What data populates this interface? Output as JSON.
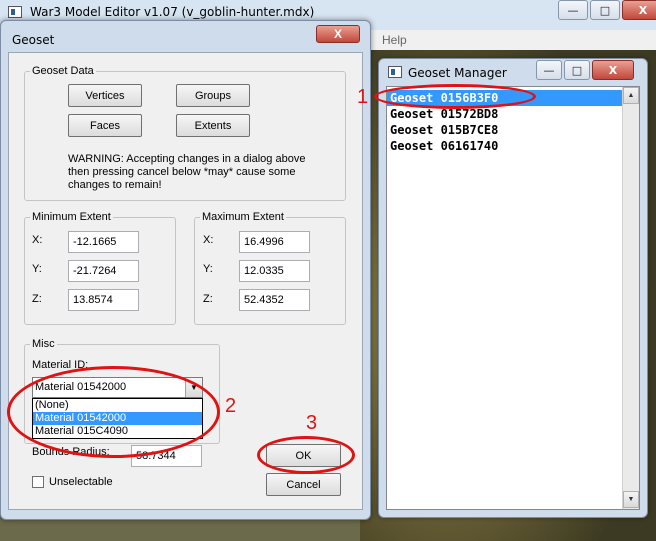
{
  "main_window": {
    "title": "War3 Model Editor v1.07 (v_goblin-hunter.mdx)",
    "menu_help": "Help",
    "buttons": {
      "minimize": "—",
      "maximize": "□",
      "close": "X"
    }
  },
  "dialog": {
    "title": "Geoset",
    "close": "X",
    "geoset_data": {
      "label": "Geoset Data",
      "vertices": "Vertices",
      "groups": "Groups",
      "faces": "Faces",
      "extents": "Extents",
      "warning": "WARNING: Accepting changes in a dialog above then pressing cancel below *may* cause some changes to remain!"
    },
    "minimum_extent": {
      "label": "Minimum Extent",
      "x_label": "X:",
      "x": "-12.1665",
      "y_label": "Y:",
      "y": "-21.7264",
      "z_label": "Z:",
      "z": "13.8574"
    },
    "maximum_extent": {
      "label": "Maximum Extent",
      "x_label": "X:",
      "x": "16.4996",
      "y_label": "Y:",
      "y": "12.0335",
      "z_label": "Z:",
      "z": "52.4352"
    },
    "misc": {
      "label": "Misc",
      "material_label": "Material ID:",
      "material_selected": "Material 01542000",
      "options": [
        "(None)",
        "Material 01542000",
        "Material 015C4090"
      ],
      "bounds_label": "Bounds Radius:",
      "bounds_value": "58.7344",
      "unselectable": "Unselectable"
    },
    "ok": "OK",
    "cancel": "Cancel"
  },
  "manager": {
    "title": "Geoset Manager",
    "buttons": {
      "minimize": "—",
      "maximize": "□",
      "close": "X"
    },
    "items": [
      "Geoset 0156B3F0",
      "Geoset 01572BD8",
      "Geoset 015B7CE8",
      "Geoset 06161740"
    ]
  },
  "annotations": {
    "one": "1",
    "two": "2",
    "three": "3"
  },
  "colors": {
    "annotation": "#e01212",
    "selection": "#3399ff",
    "chrome": "#cfdcec"
  }
}
